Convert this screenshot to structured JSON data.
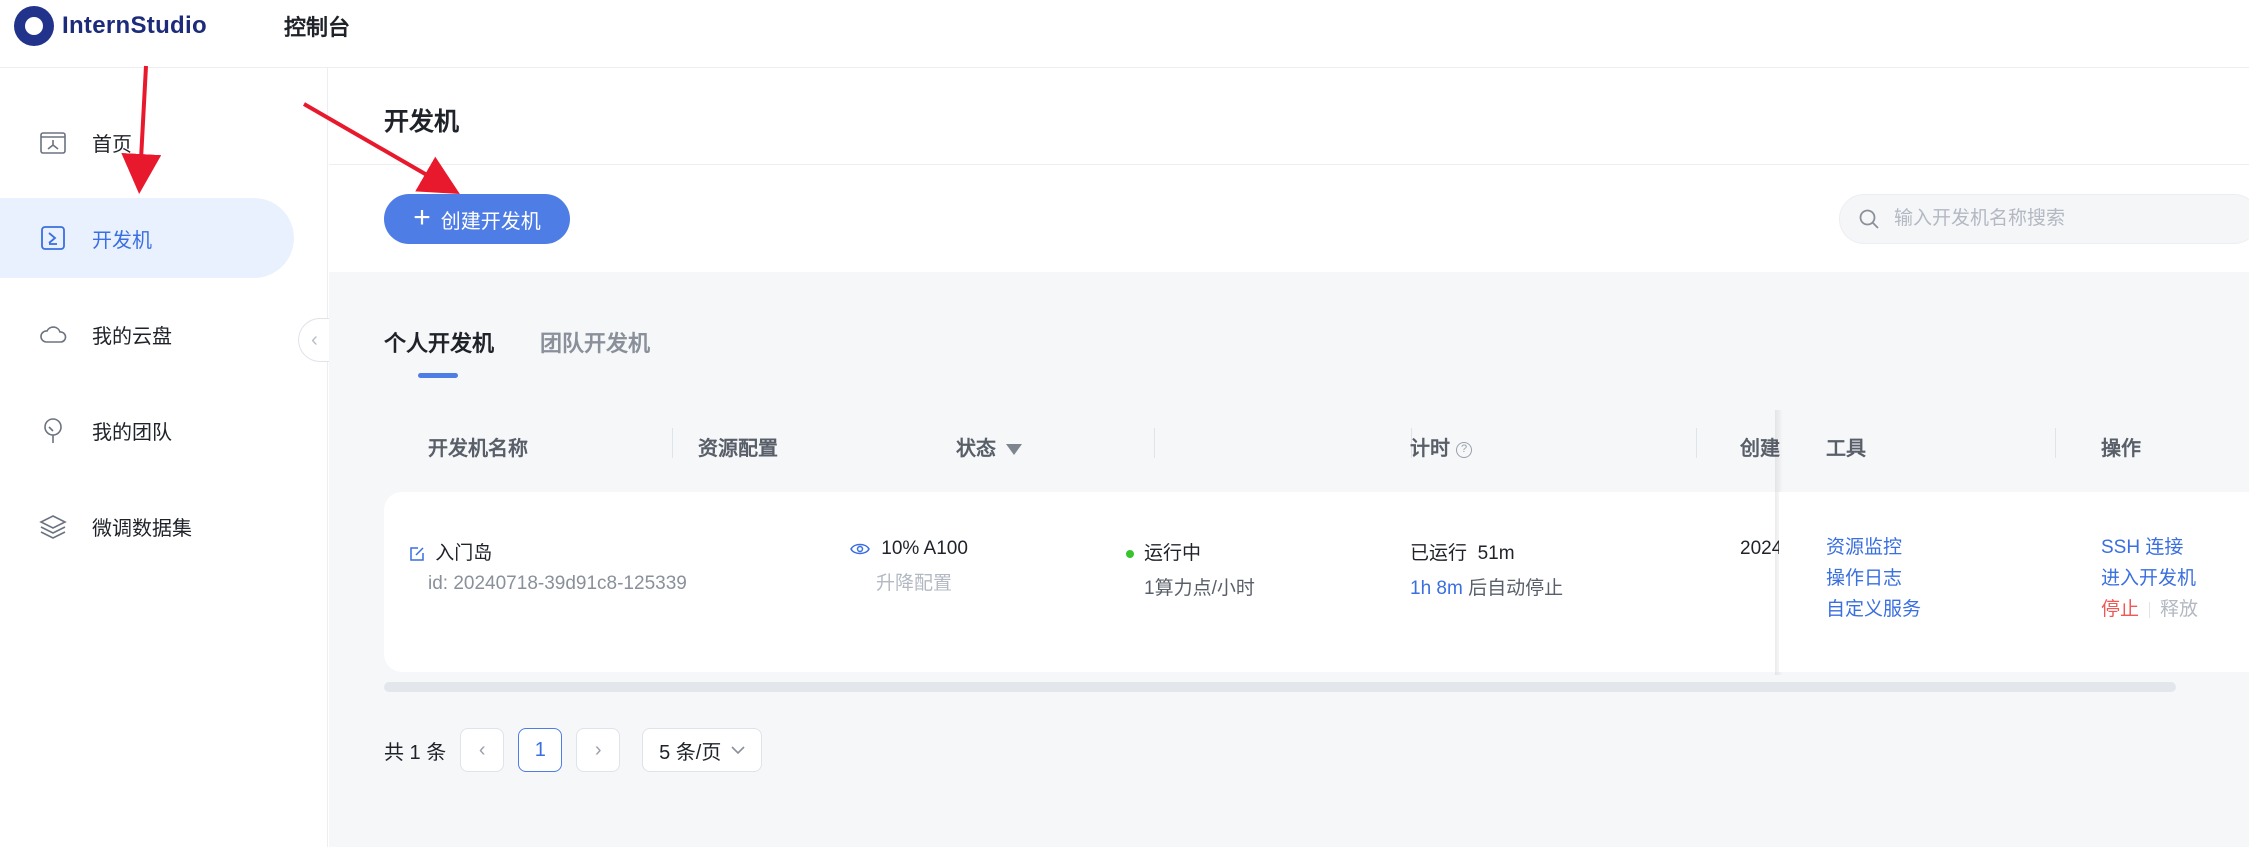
{
  "header": {
    "logo_text": "InternStudio",
    "console_label": "控制台"
  },
  "sidebar": {
    "items": [
      {
        "label": "首页",
        "icon": "home-icon",
        "active": false
      },
      {
        "label": "开发机",
        "icon": "terminal-icon",
        "active": true
      },
      {
        "label": "我的云盘",
        "icon": "cloud-icon",
        "active": false
      },
      {
        "label": "我的团队",
        "icon": "team-tree-icon",
        "active": false
      },
      {
        "label": "微调数据集",
        "icon": "layers-icon",
        "active": false
      }
    ],
    "collapse_icon": "chevron-left-icon"
  },
  "main": {
    "title": "开发机",
    "create_button": "创建开发机",
    "search_placeholder": "输入开发机名称搜索",
    "tabs": [
      {
        "label": "个人开发机",
        "active": true
      },
      {
        "label": "团队开发机",
        "active": false
      }
    ],
    "table": {
      "columns": {
        "name": "开发机名称",
        "resource": "资源配置",
        "status": "状态",
        "timer": "计时",
        "created": "创建",
        "tools": "工具",
        "actions": "操作"
      },
      "rows": [
        {
          "name": "入门岛",
          "id": "id: 20240718-39d91c8-125339",
          "resource": "10% A100",
          "resource_action": "升降配置",
          "status": "运行中",
          "status_color": "#37c42c",
          "cost": "1算力点/小时",
          "running_label": "已运行",
          "running_time": "51m",
          "auto_stop_time": "1h 8m",
          "auto_stop_suffix": "后自动停止",
          "created": "2024",
          "tools": [
            "资源监控",
            "操作日志",
            "自定义服务"
          ],
          "actions": {
            "ssh": "SSH 连接",
            "enter": "进入开发机",
            "stop": "停止",
            "release": "释放"
          }
        }
      ]
    },
    "pagination": {
      "total": "共 1 条",
      "current_page": "1",
      "page_size": "5 条/页"
    }
  },
  "colors": {
    "primary": "#4f7de6",
    "active_nav_bg": "#eaf1fe",
    "danger": "#f05757",
    "annotation_arrow": "#e8192c"
  }
}
